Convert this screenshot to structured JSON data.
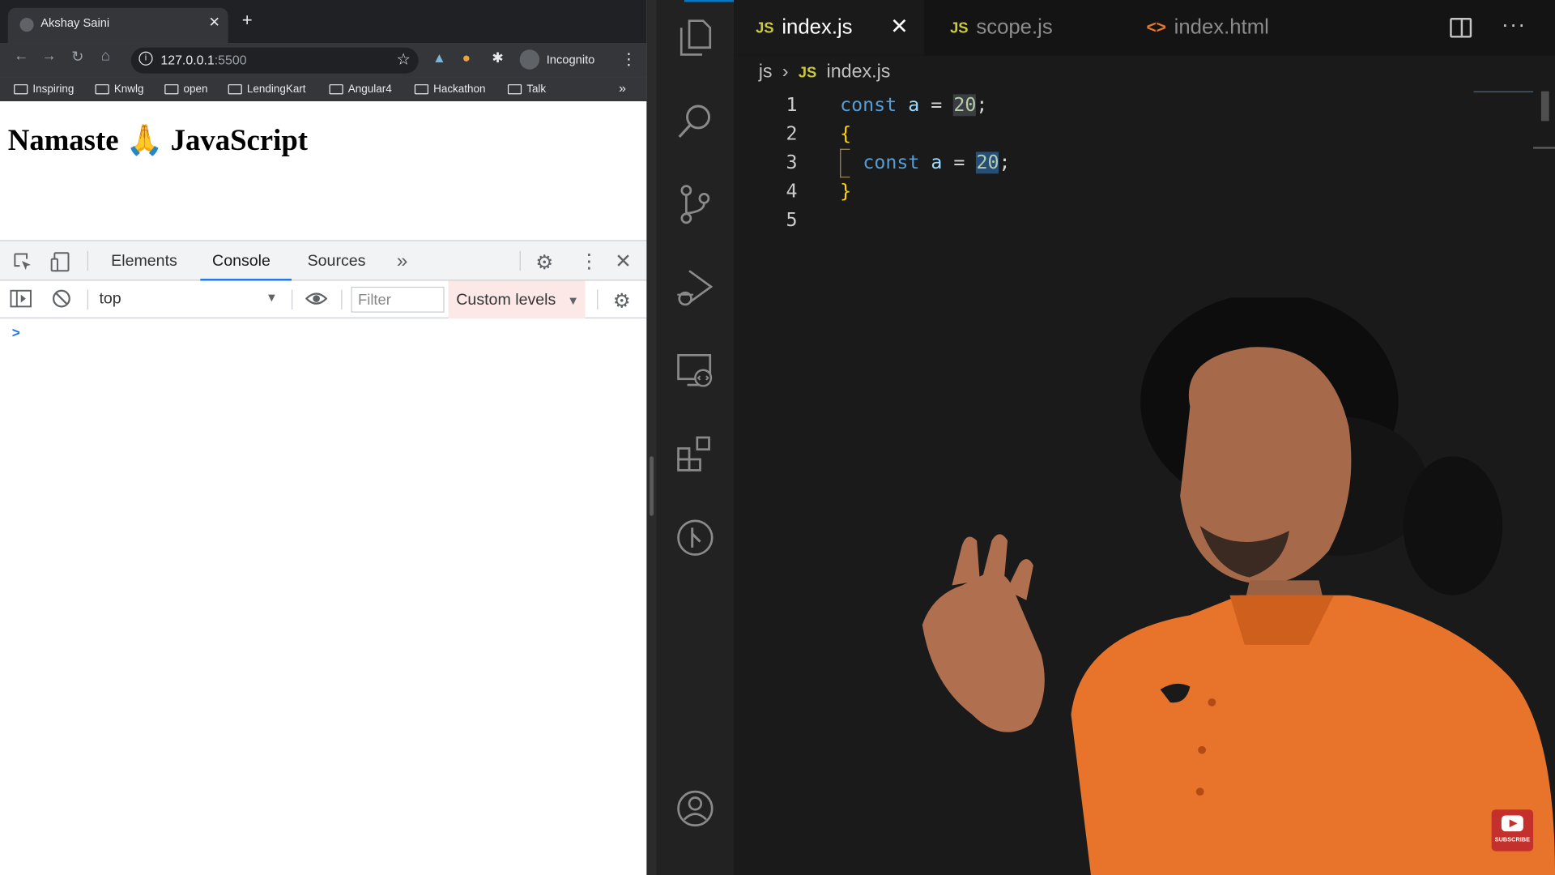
{
  "browser": {
    "tab_title": "Akshay Saini",
    "new_tab_symbol": "+",
    "url_host": "127.0.0.1",
    "url_port": ":5500",
    "incognito_label": "Incognito",
    "bookmarks": [
      "Inspiring",
      "Knwlg",
      "open",
      "LendingKart",
      "Angular4",
      "Hackathon",
      "Talk"
    ],
    "bookmarks_more": "»",
    "page_heading": "Namaste 🙏 JavaScript"
  },
  "devtools": {
    "tabs": [
      "Elements",
      "Console",
      "Sources"
    ],
    "active_tab": "Console",
    "more_tabs": "»",
    "context": "top",
    "filter_placeholder": "Filter",
    "levels_label": "Custom levels",
    "prompt_symbol": ">"
  },
  "vscode": {
    "tabs": [
      {
        "badge": "JS",
        "label": "index.js",
        "active": true
      },
      {
        "badge": "JS",
        "label": "scope.js",
        "active": false
      },
      {
        "badge": "<>",
        "label": "index.html",
        "active": false
      }
    ],
    "breadcrumb": {
      "folder": "js",
      "file_badge": "JS",
      "file": "index.js"
    },
    "line_numbers": [
      "1",
      "2",
      "3",
      "4",
      "5"
    ],
    "code": {
      "kw": "const",
      "var": "a",
      "op": "=",
      "value": "20",
      "semi": ";",
      "open_brace": "{",
      "close_brace": "}"
    }
  },
  "overlay": {
    "subscribe_label": "SUBSCRIBE"
  },
  "colors": {
    "accent": "#007acc",
    "js_badge": "#cbcb41",
    "html_badge": "#e37933",
    "console_tab_underline": "#1a73e8",
    "shirt": "#e8732a"
  }
}
